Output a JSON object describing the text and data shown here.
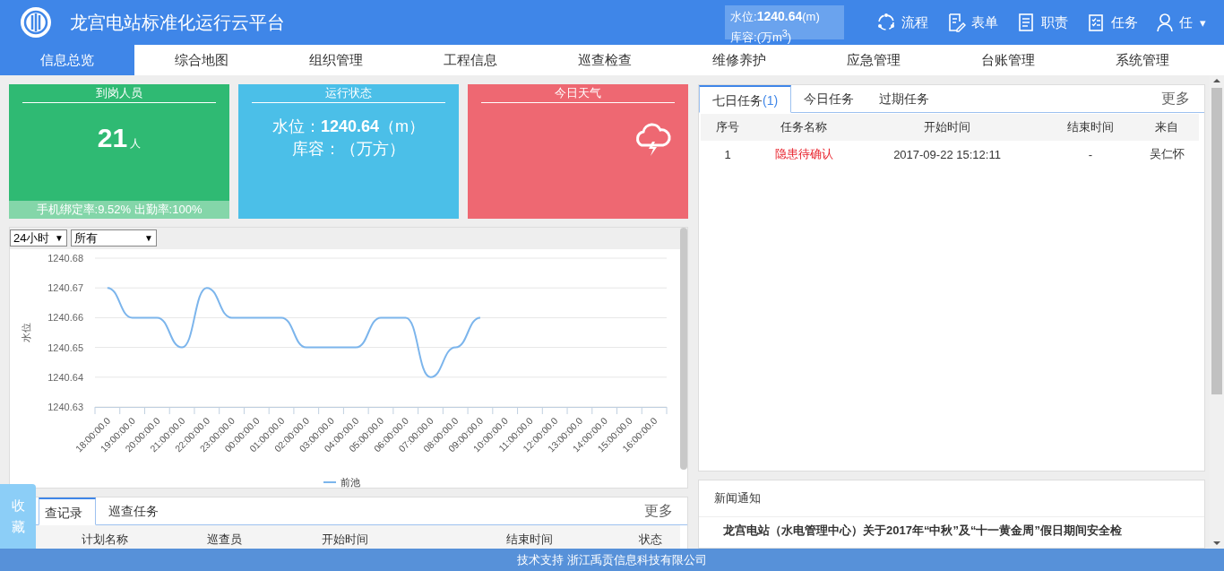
{
  "header": {
    "title": "龙宫电站标准化运行云平台",
    "water_level": {
      "label": "水位:",
      "value": "1240.64",
      "unit": "(m)"
    },
    "capacity": {
      "label": "库容:",
      "unit": "(万m$^{3}$)"
    },
    "actions": [
      {
        "kind": "flow",
        "label": "流程"
      },
      {
        "kind": "form",
        "label": "表单"
      },
      {
        "kind": "duty",
        "label": "职责"
      },
      {
        "kind": "task",
        "label": "任务"
      }
    ],
    "user": {
      "name": "任",
      "caret": "▾"
    }
  },
  "nav": [
    {
      "label": "信息总览",
      "selected": true
    },
    {
      "label": "综合地图",
      "selected": false
    },
    {
      "label": "组织管理",
      "selected": false
    },
    {
      "label": "工程信息",
      "selected": false
    },
    {
      "label": "巡查检查",
      "selected": false
    },
    {
      "label": "维修养护",
      "selected": false
    },
    {
      "label": "应急管理",
      "selected": false
    },
    {
      "label": "台账管理",
      "selected": false
    },
    {
      "label": "系统管理",
      "selected": false
    }
  ],
  "cards": [
    {
      "kind": "staff",
      "title": "到岗人员",
      "color": "#2fba73",
      "count": "21",
      "unit": "人",
      "footer": "手机绑定率:9.52% 出勤率:100%"
    },
    {
      "kind": "status",
      "title": "运行状态",
      "color": "#4bbfe8",
      "lines": [
        "水位：**1240.64**（m）",
        "库容：（万方）"
      ]
    },
    {
      "kind": "weather",
      "title": "今日天气",
      "color": "#ee6872"
    }
  ],
  "chart_panel": {
    "filters": [
      {
        "value": "24小时",
        "caret": "▼"
      },
      {
        "value": "所有",
        "caret": "▼"
      }
    ],
    "chart_data": {
      "type": "line",
      "ylabel": "水位",
      "categories": [
        "18:00:00.0",
        "19:00:00.0",
        "20:00:00.0",
        "21:00:00.0",
        "22:00:00.0",
        "23:00:00.0",
        "00:00:00.0",
        "01:00:00.0",
        "02:00:00.0",
        "03:00:00.0",
        "04:00:00.0",
        "05:00:00.0",
        "06:00:00.0",
        "07:00:00.0",
        "08:00:00.0",
        "09:00:00.0",
        "10:00:00.0",
        "11:00:00.0",
        "12:00:00.0",
        "13:00:00.0",
        "14:00:00.0",
        "15:00:00.0",
        "16:00:00.0"
      ],
      "series": [
        {
          "name": "前池",
          "color": "#7cb5ec",
          "values": [
            1240.67,
            1240.66,
            1240.66,
            1240.65,
            1240.67,
            1240.66,
            1240.66,
            1240.66,
            1240.65,
            1240.65,
            1240.65,
            1240.66,
            1240.66,
            1240.64,
            1240.65,
            1240.66,
            null,
            null,
            null,
            null,
            null,
            null,
            null
          ]
        }
      ],
      "grid": true,
      "ylim": [
        1240.63,
        1240.68
      ],
      "yticks": [
        1240.63,
        1240.64,
        1240.65,
        1240.66,
        1240.67,
        1240.68
      ]
    }
  },
  "tasks": {
    "tabs": [
      {
        "label": "七日任务",
        "count": "(1)",
        "selected": true
      },
      {
        "label": "今日任务",
        "selected": false
      },
      {
        "label": "过期任务",
        "selected": false
      }
    ],
    "more": "更多",
    "columns": [
      "序号",
      "任务名称",
      "开始时间",
      "结束时间",
      "来自"
    ],
    "rows": [
      {
        "cells": [
          "1",
          "隐患待确认",
          "2017-09-22 15:12:11",
          "-",
          "吴仁怀"
        ]
      }
    ]
  },
  "patrol": {
    "tabs": [
      {
        "label": "查记录",
        "selected": true
      },
      {
        "label": "巡查任务",
        "selected": false
      }
    ],
    "more": "更多",
    "columns": [
      "计划名称",
      "巡查员",
      "开始时间",
      "结束时间",
      "状态"
    ]
  },
  "news": {
    "title": "新闻通知",
    "items": [
      "龙宫电站（水电管理中心）关于2017年“中秋”及“十一黄金周”假日期间安全检"
    ]
  },
  "favorite": "收藏",
  "footer": "技术支持 浙江禹贡信息科技有限公司"
}
